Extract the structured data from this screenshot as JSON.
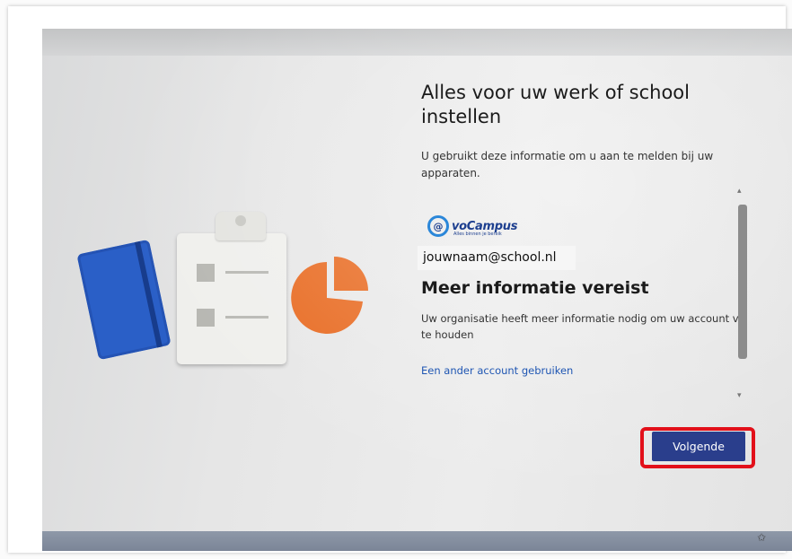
{
  "screen": {
    "title": "Alles voor uw werk of school instellen",
    "subtitle": "U gebruikt deze informatie om u aan te melden bij uw apparaten.",
    "logo": {
      "mark": "@",
      "name": "voCampus",
      "tagline": "Alles binnen je bereik"
    },
    "account": "jouwnaam@school.nl",
    "heading": "Meer informatie vereist",
    "message_line1": "Uw organisatie heeft meer informatie nodig om uw account veilig",
    "message_line2": "te houden",
    "other_account_link": "Een ander account gebruiken",
    "next_button": "Volgende"
  },
  "colors": {
    "accent": "#2a3e8c",
    "highlight": "#e2101a",
    "link": "#1f56b3",
    "pie": "#e8691f"
  },
  "icons": {
    "scroll_up": "chevron-up-icon",
    "scroll_down": "chevron-down-icon",
    "corner": "accessibility-icon"
  }
}
